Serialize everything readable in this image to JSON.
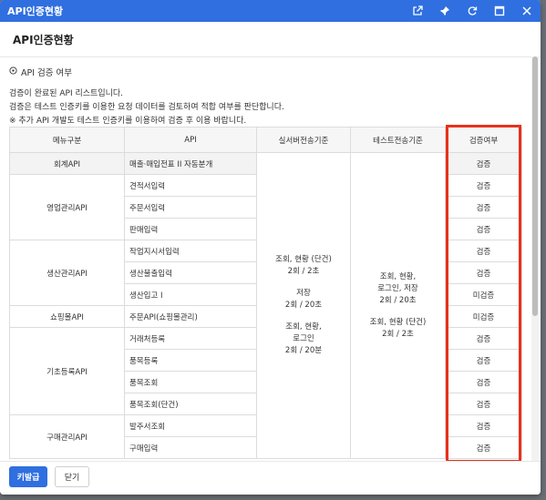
{
  "window": {
    "title": "API인증현황",
    "icons": [
      "external-link-icon",
      "pin-icon",
      "refresh-icon",
      "maximize-icon",
      "close-icon"
    ]
  },
  "header": {
    "title": "API인증현황"
  },
  "section": {
    "title": "API 검증 여부"
  },
  "description": [
    "검증이 완료된 API 리스트입니다.",
    "검증은 테스트 인증키를 이용한 요청 데이터를 검토하여 적합 여부를 판단합니다.",
    "※ 추가 API 개발도 테스트 인증키를 이용하여 검증 후 이용 바랍니다."
  ],
  "table": {
    "headers": [
      "메뉴구분",
      "API",
      "실서버전송기준",
      "테스트전송기준",
      "검증여부"
    ],
    "categories": [
      "회계API",
      "영업관리API",
      "생산관리API",
      "쇼핑몰API",
      "기초등록API",
      "구매관리API"
    ],
    "apis": [
      "매출·매입전표 II 자동분개",
      "견적서입력",
      "주문서입력",
      "판매입력",
      "작업지시서입력",
      "생산불출입력",
      "생산입고 I",
      "주문API(쇼핑몰관리)",
      "거래처등록",
      "품목등록",
      "품목조회",
      "품목조회(단건)",
      "발주서조회",
      "구매입력"
    ],
    "status": [
      "검증",
      "검증",
      "검증",
      "검증",
      "검증",
      "검증",
      "미검증",
      "미검증",
      "검증",
      "검증",
      "검증",
      "검증",
      "검증",
      "검증"
    ],
    "real_server": [
      "조회, 현황 (단건)",
      "2회 / 2초",
      "저장",
      "2회 / 20초",
      "조회, 현황,",
      "로그인",
      "2회 / 20분"
    ],
    "test_server": [
      "조회, 현황,",
      "로그인, 저장",
      "2회 / 20초",
      "조회, 현황 (단건)",
      "2회 / 2초"
    ]
  },
  "footer": {
    "primary_label": "키발급",
    "close_label": "닫기"
  },
  "colors": {
    "accent": "#2f6fe0",
    "highlight": "#e8301c"
  }
}
